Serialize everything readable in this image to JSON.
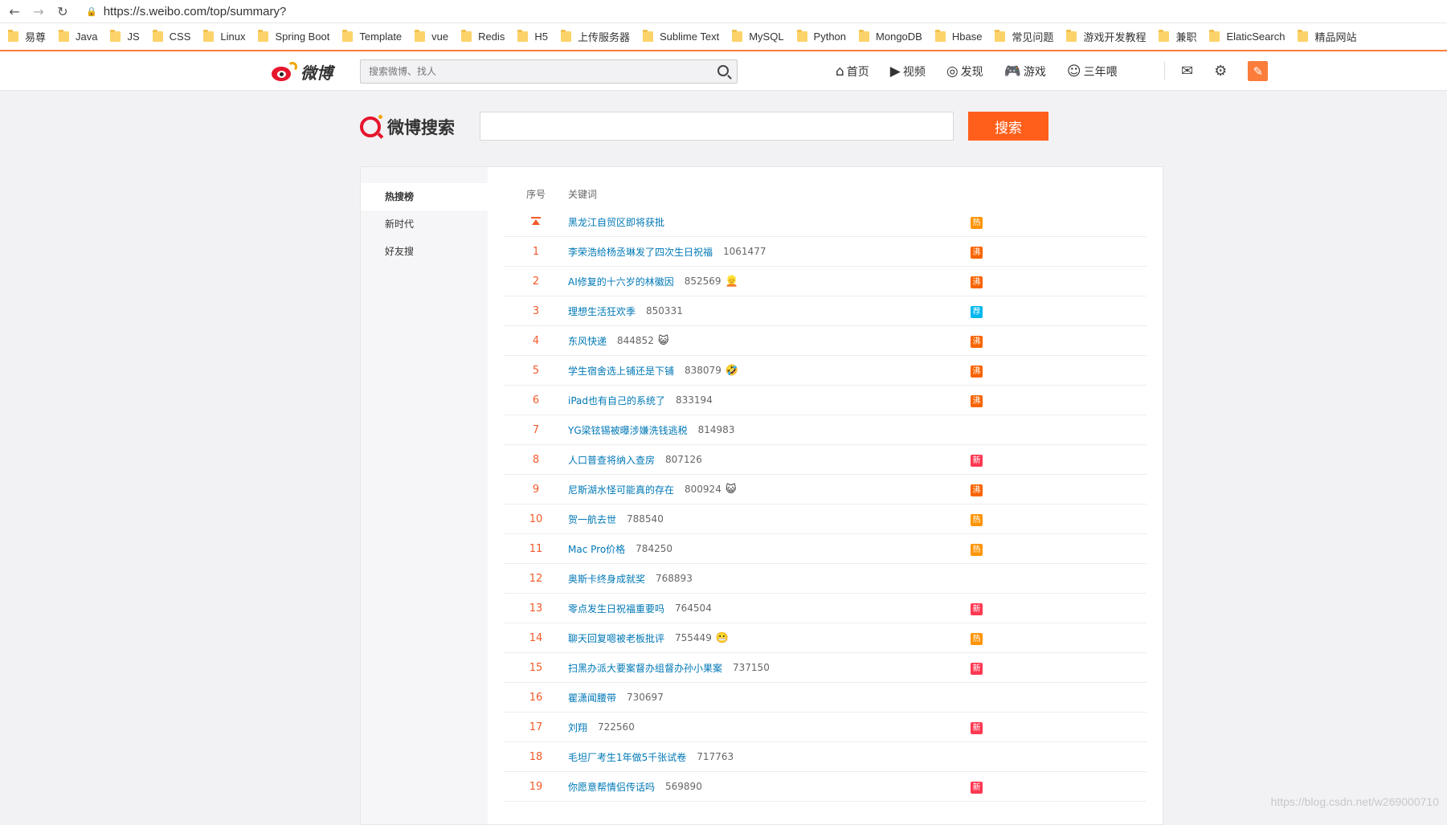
{
  "browser": {
    "url": "https://s.weibo.com/top/summary?",
    "bookmarks": [
      "易尊",
      "Java",
      "JS",
      "CSS",
      "Linux",
      "Spring Boot",
      "Template",
      "vue",
      "Redis",
      "H5",
      "上传服务器",
      "Sublime Text",
      "MySQL",
      "Python",
      "MongoDB",
      "Hbase",
      "常见问题",
      "游戏开发教程",
      "兼职",
      "ElaticSearch",
      "精品网站"
    ]
  },
  "weibo_nav": {
    "logo_text": "微博",
    "search_placeholder": "搜索微博、找人",
    "menu": [
      {
        "icon": "home-icon",
        "label": "首页"
      },
      {
        "icon": "video-icon",
        "label": "视频"
      },
      {
        "icon": "discover-icon",
        "label": "发现"
      },
      {
        "icon": "game-icon",
        "label": "游戏"
      },
      {
        "icon": "user-icon",
        "label": "三年喂"
      }
    ]
  },
  "search_header": {
    "title": "微博搜索",
    "button": "搜索"
  },
  "sidebar": {
    "items": [
      "热搜榜",
      "新时代",
      "好友搜"
    ]
  },
  "table": {
    "col_rank": "序号",
    "col_keyword": "关键词",
    "rows": [
      {
        "rank": "",
        "pinned": true,
        "keyword": "黑龙江自贸区即将获批",
        "count": "",
        "emoji": "",
        "tag": "热",
        "tag_type": "hot"
      },
      {
        "rank": "1",
        "keyword": "李荣浩给杨丞琳发了四次生日祝福",
        "count": "1061477",
        "emoji": "",
        "tag": "沸",
        "tag_type": "boil"
      },
      {
        "rank": "2",
        "keyword": "AI修复的十六岁的林徽因",
        "count": "852569",
        "emoji": "👱",
        "tag": "沸",
        "tag_type": "boil"
      },
      {
        "rank": "3",
        "keyword": "理想生活狂欢季",
        "count": "850331",
        "emoji": "",
        "tag": "荐",
        "tag_type": "rec"
      },
      {
        "rank": "4",
        "keyword": "东风快递",
        "count": "844852",
        "emoji": "😺",
        "tag": "沸",
        "tag_type": "boil"
      },
      {
        "rank": "5",
        "keyword": "学生宿舍选上铺还是下铺",
        "count": "838079",
        "emoji": "🤣",
        "tag": "沸",
        "tag_type": "boil"
      },
      {
        "rank": "6",
        "keyword": "iPad也有自己的系统了",
        "count": "833194",
        "emoji": "",
        "tag": "沸",
        "tag_type": "boil"
      },
      {
        "rank": "7",
        "keyword": "YG梁铉锡被曝涉嫌洗钱逃税",
        "count": "814983",
        "emoji": "",
        "tag": "",
        "tag_type": ""
      },
      {
        "rank": "8",
        "keyword": "人口普查将纳入查房",
        "count": "807126",
        "emoji": "",
        "tag": "新",
        "tag_type": "new"
      },
      {
        "rank": "9",
        "keyword": "尼斯湖水怪可能真的存在",
        "count": "800924",
        "emoji": "😺",
        "tag": "沸",
        "tag_type": "boil"
      },
      {
        "rank": "10",
        "keyword": "贺一航去世",
        "count": "788540",
        "emoji": "",
        "tag": "热",
        "tag_type": "hot"
      },
      {
        "rank": "11",
        "keyword": "Mac Pro价格",
        "count": "784250",
        "emoji": "",
        "tag": "热",
        "tag_type": "hot"
      },
      {
        "rank": "12",
        "keyword": "奥斯卡终身成就奖",
        "count": "768893",
        "emoji": "",
        "tag": "",
        "tag_type": ""
      },
      {
        "rank": "13",
        "keyword": "零点发生日祝福重要吗",
        "count": "764504",
        "emoji": "",
        "tag": "新",
        "tag_type": "new"
      },
      {
        "rank": "14",
        "keyword": "聊天回复嗯被老板批评",
        "count": "755449",
        "emoji": "😬",
        "tag": "热",
        "tag_type": "hot"
      },
      {
        "rank": "15",
        "keyword": "扫黑办派大要案督办组督办孙小果案",
        "count": "737150",
        "emoji": "",
        "tag": "新",
        "tag_type": "new"
      },
      {
        "rank": "16",
        "keyword": "瞿潇闻腰带",
        "count": "730697",
        "emoji": "",
        "tag": "",
        "tag_type": ""
      },
      {
        "rank": "17",
        "keyword": "刘翔",
        "count": "722560",
        "emoji": "",
        "tag": "新",
        "tag_type": "new"
      },
      {
        "rank": "18",
        "keyword": "毛坦厂考生1年做5千张试卷",
        "count": "717763",
        "emoji": "",
        "tag": "",
        "tag_type": ""
      },
      {
        "rank": "19",
        "keyword": "你愿意帮情侣传话吗",
        "count": "569890",
        "emoji": "",
        "tag": "新",
        "tag_type": "new"
      }
    ]
  },
  "watermark": "https://blog.csdn.net/w269000710",
  "colors": {
    "accent": "#ff5f1b",
    "link": "#0078b6",
    "rank": "#f25a29"
  }
}
